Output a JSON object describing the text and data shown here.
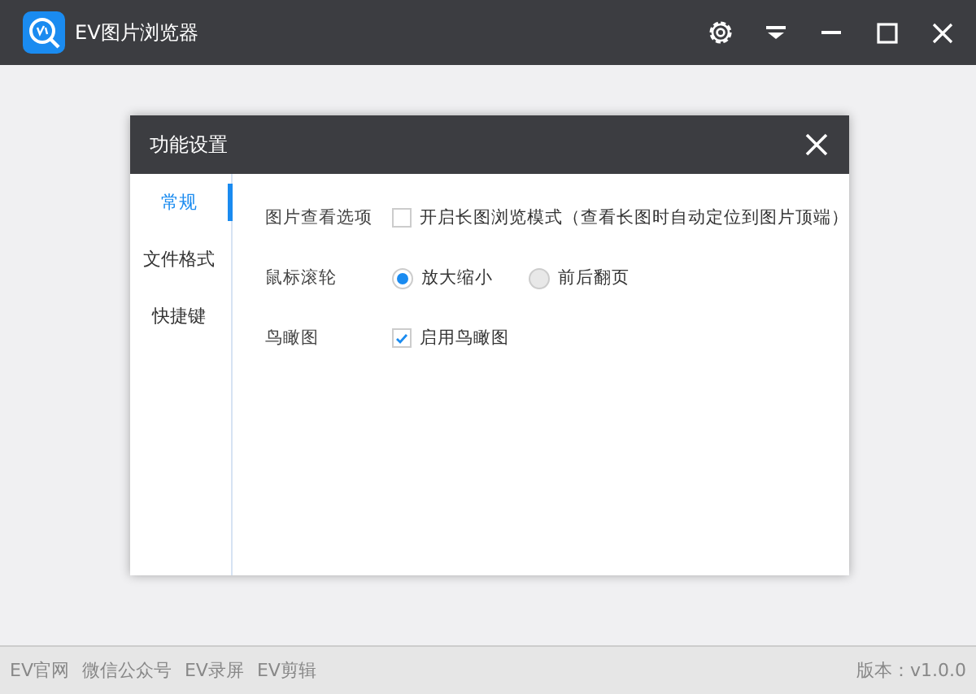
{
  "window": {
    "title": "EV图片浏览器"
  },
  "dialog": {
    "title": "功能设置",
    "sidebar": {
      "items": [
        {
          "label": "常规",
          "selected": true
        },
        {
          "label": "文件格式",
          "selected": false
        },
        {
          "label": "快捷键",
          "selected": false
        }
      ]
    },
    "settings": [
      {
        "label": "图片查看选项",
        "kind": "checkbox",
        "options": [
          {
            "label": "开启长图浏览模式（查看长图时自动定位到图片顶端）",
            "checked": false
          }
        ]
      },
      {
        "label": "鼠标滚轮",
        "kind": "radio",
        "options": [
          {
            "label": "放大缩小",
            "selected": true
          },
          {
            "label": "前后翻页",
            "selected": false
          }
        ]
      },
      {
        "label": "鸟瞰图",
        "kind": "checkbox",
        "options": [
          {
            "label": "启用鸟瞰图",
            "checked": true
          }
        ]
      }
    ]
  },
  "status_bar": {
    "links": [
      "EV官网",
      "微信公众号",
      "EV录屏",
      "EV剪辑"
    ],
    "version": "版本：v1.0.0"
  }
}
